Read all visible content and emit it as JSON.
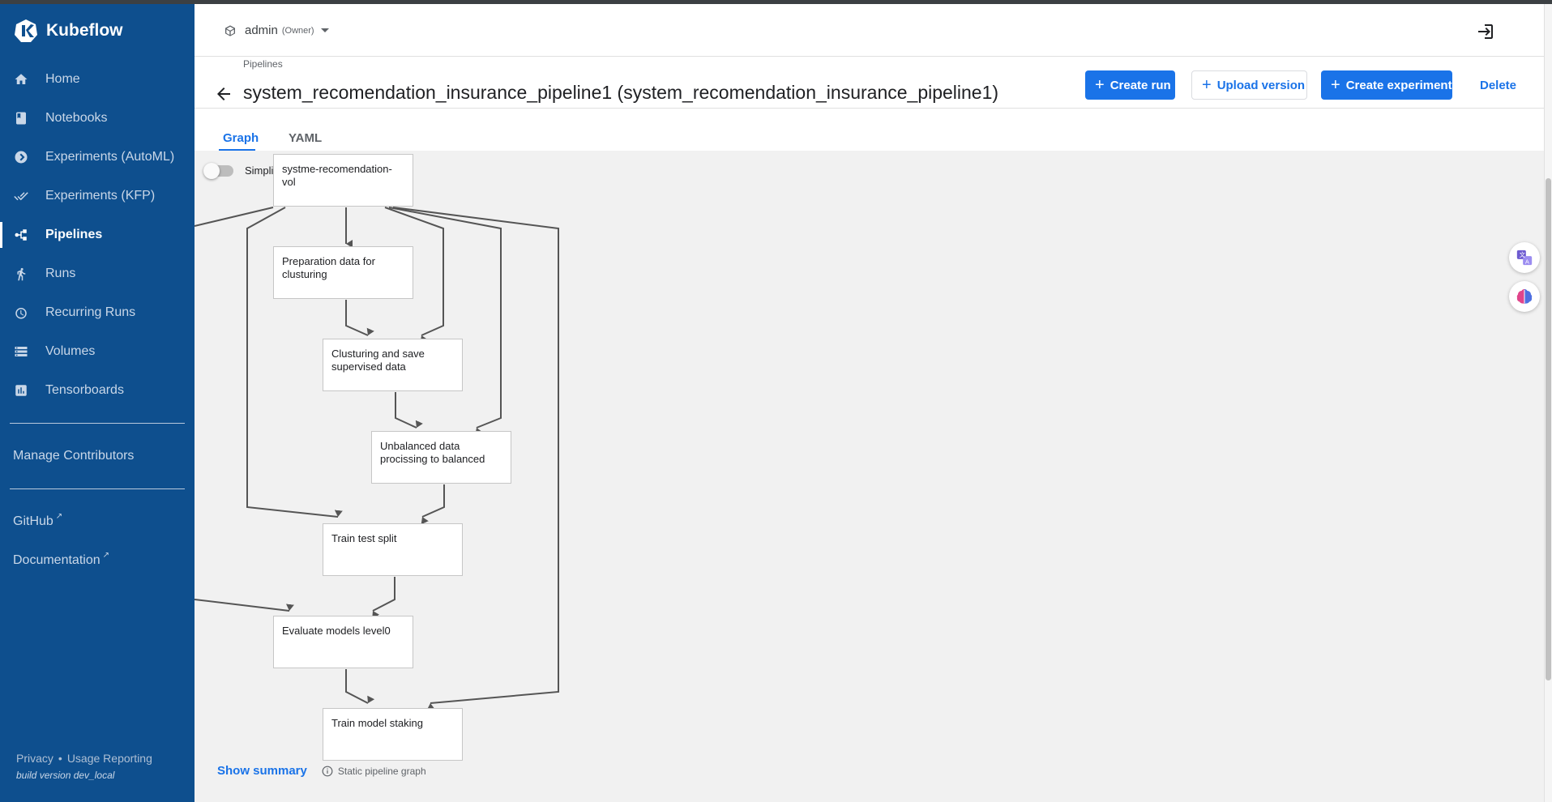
{
  "app": {
    "name": "Kubeflow"
  },
  "sidebar": {
    "items": [
      {
        "label": "Home",
        "icon": "home-icon"
      },
      {
        "label": "Notebooks",
        "icon": "book-icon"
      },
      {
        "label": "Experiments (AutoML)",
        "icon": "automl-icon"
      },
      {
        "label": "Experiments (KFP)",
        "icon": "done-all-icon"
      },
      {
        "label": "Pipelines",
        "icon": "pipelines-icon",
        "active": true
      },
      {
        "label": "Runs",
        "icon": "run-icon"
      },
      {
        "label": "Recurring Runs",
        "icon": "alarm-icon"
      },
      {
        "label": "Volumes",
        "icon": "storage-icon"
      },
      {
        "label": "Tensorboards",
        "icon": "chart-icon"
      }
    ],
    "manage_contributors": "Manage Contributors",
    "github": "GitHub",
    "documentation": "Documentation",
    "footer": {
      "privacy": "Privacy",
      "separator": "•",
      "usage": "Usage Reporting",
      "build": "build version dev_local"
    }
  },
  "header": {
    "namespace": "admin",
    "role": "(Owner)"
  },
  "page": {
    "breadcrumb": "Pipelines",
    "title": "system_recomendation_insurance_pipeline1 (system_recomendation_insurance_pipeline1)",
    "buttons": {
      "create_run": "Create run",
      "upload_version": "Upload version",
      "create_experiment": "Create experiment",
      "delete": "Delete"
    },
    "tabs": [
      "Graph",
      "YAML"
    ],
    "active_tab": "Graph"
  },
  "graph": {
    "simplify_label": "Simplify Graph",
    "nodes": [
      "systme-recomendation-vol",
      "Preparation data for clusturing",
      "Clusturing and save supervised data",
      "Unbalanced data procissing to balanced",
      "Train test split",
      "Evaluate models level0",
      "Train model staking"
    ],
    "show_summary": "Show summary",
    "static_label": "Static pipeline graph"
  },
  "colors": {
    "sidebar_bg": "#0e4f8e",
    "accent": "#1a73e8",
    "graph_bg": "#f1f1f1"
  }
}
